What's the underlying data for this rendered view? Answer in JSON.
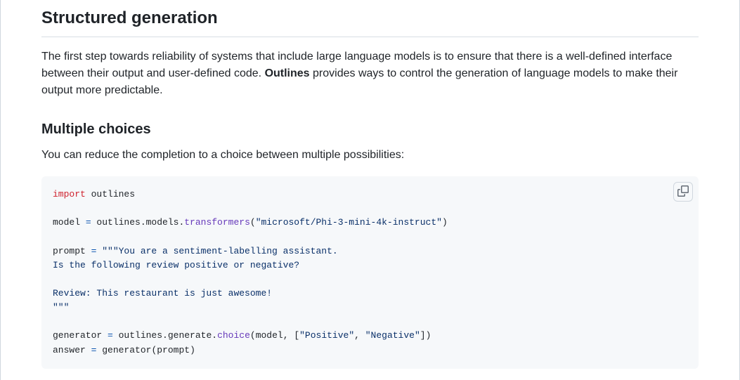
{
  "section": {
    "title": "Structured generation",
    "lead_pre": "The first step towards reliability of systems that include large language models is to ensure that there is a well-defined interface between their output and user-defined code. ",
    "lead_bold": "Outlines",
    "lead_post": " provides ways to control the generation of language models to make their output more predictable."
  },
  "subsection": {
    "title": "Multiple choices",
    "body": "You can reduce the completion to a choice between multiple possibilities:"
  },
  "code": {
    "t_import": "import",
    "t_sp": " ",
    "t_outlines": "outlines",
    "t_nl": "\n",
    "t_model": "model",
    "t_eq": " = ",
    "t_outlines_models": "outlines.models.",
    "t_transformers": "transformers",
    "t_lp": "(",
    "t_model_str": "\"microsoft/Phi-3-mini-4k-instruct\"",
    "t_rp": ")",
    "t_prompt": "prompt",
    "t_prompt_str": "\"\"\"You are a sentiment-labelling assistant.\nIs the following review positive or negative?\n\nReview: This restaurant is just awesome!\n\"\"\"",
    "t_generator": "generator",
    "t_outlines_generate": "outlines.generate.",
    "t_choice": "choice",
    "t_model_id": "model",
    "t_comma_sp": ", ",
    "t_lb": "[",
    "t_pos": "\"Positive\"",
    "t_neg": "\"Negative\"",
    "t_rb": "]",
    "t_answer": "answer",
    "t_generator_id": "generator",
    "t_prompt_id": "prompt"
  },
  "copy_label": "Copy"
}
